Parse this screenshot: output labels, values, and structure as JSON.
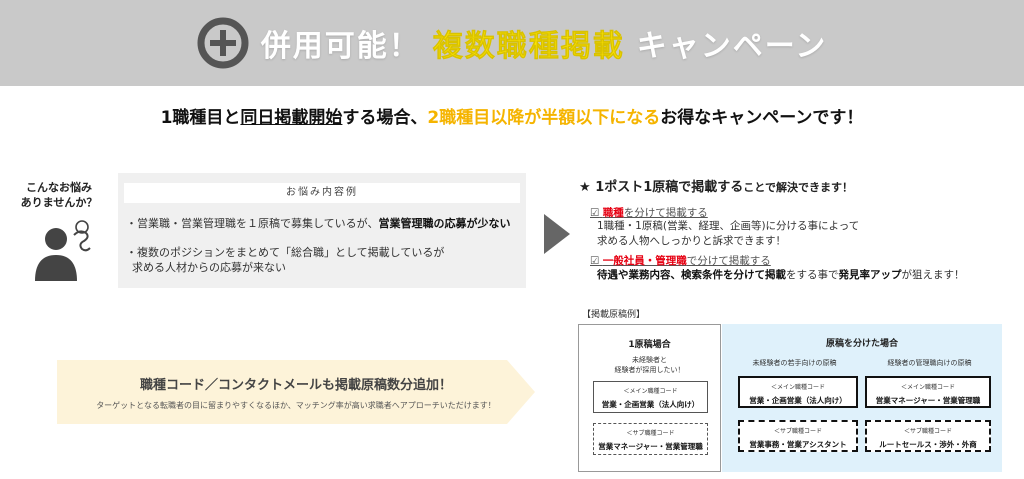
{
  "banner": {
    "icon": "plus-circle-icon",
    "prefix": "併用可能！",
    "highlight": "複数職種掲載",
    "suffix": "キャンペーン"
  },
  "headline": {
    "part1": "1職種目と",
    "part2_underlined": "同日掲載開始",
    "part3": "する場合、",
    "part4_accent": "2職種目以降が半額以下になる",
    "part5": "お得なキャンペーンです！",
    "accent_color": "#f5b400"
  },
  "worry": {
    "question_line1": "こんなお悩み",
    "question_line2": "ありませんか？",
    "box_title": "お悩み内容例",
    "item1_pre": "・営業職・営業管理職を１原稿で募集しているが、",
    "item1_bold": "営業管理職の応募が少ない",
    "item2_line1": "・複数のポジションをまとめて「総合職」として掲載しているが",
    "item2_line2": "求める人材からの応募が来ない"
  },
  "solution": {
    "star": "★",
    "title_bold": "1ポスト1原稿で掲載する",
    "title_rest": "ことで解決できます！",
    "check1_box": "☑",
    "check1_red": "職種",
    "check1_rest": "を分けて掲載する",
    "check1_detail1": "1職種・1原稿(営業、経理、企画等)に分ける事によって",
    "check1_detail2": "求める人物へしっかりと訴求できます！",
    "check2_box": "☑",
    "check2_red": "一般社員・管理職",
    "check2_rest": "で分けて掲載する",
    "check2_detail_bold1": "待遇や業務内容、検索条件を分けて掲載",
    "check2_detail_mid": "をする事で",
    "check2_detail_bold2": "発見率アップ",
    "check2_detail_end": "が狙えます！"
  },
  "example": {
    "label": "【掲載原稿例】",
    "single": {
      "title": "1原稿場合",
      "sub1": "未経験者と",
      "sub2": "経験者が採用したい！",
      "main_label": "＜メイン職種コード",
      "main_value": "営業・企画営業（法人向け）",
      "sub_label": "＜サブ職種コード",
      "sub_value": "営業マネージャー・営業管理職"
    },
    "split": {
      "title": "原稿を分けた場合",
      "left_head": "未経験者の若手向けの原稿",
      "right_head": "経験者の管理職向けの原稿",
      "left_main_label": "＜メイン職種コード",
      "left_main_value": "営業・企画営業（法人向け）",
      "left_sub_label": "＜サブ職種コード",
      "left_sub_value": "営業事務・営業アシスタント",
      "right_main_label": "＜メイン職種コード",
      "right_main_value": "営業マネージャー・営業管理職",
      "right_sub_label": "＜サブ職種コード",
      "right_sub_value": "ルートセールス・渉外・外商"
    }
  },
  "promo": {
    "title": "職種コード／コンタクトメールも掲載原稿数分追加！",
    "subtitle": "ターゲットとなる転職者の目に留まりやすくなるほか、マッチング率が高い求職者へアプローチいただけます！",
    "background_color": "#fdf3d9"
  }
}
